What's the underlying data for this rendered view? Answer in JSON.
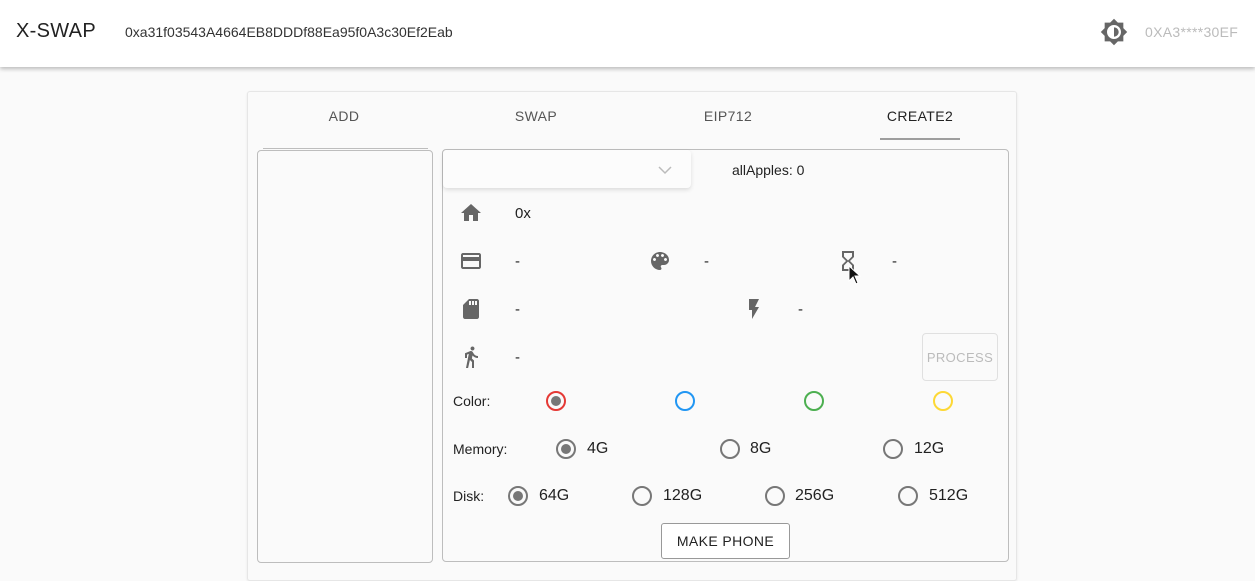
{
  "header": {
    "brand": "X-SWAP",
    "contract_address": "0xa31f03543A4664EB8DDDf88Ea95f0A3c30Ef2Eab",
    "theme_icon": "brightness-icon",
    "account": "0XA3****30EF"
  },
  "tabs": [
    {
      "label": "ADD"
    },
    {
      "label": "SWAP"
    },
    {
      "label": "EIP712"
    },
    {
      "label": "CREATE2",
      "active": true
    }
  ],
  "panel": {
    "select_value": "",
    "all_apples": "allApples: 0",
    "address_value": "0x",
    "card_value": "-",
    "palette_value": "-",
    "hourglass_value": "-",
    "storage_value": "-",
    "flash_value": "-",
    "person_value": "-",
    "process_label": "PROCESS",
    "color_label": "Color:",
    "colors": [
      {
        "hex": "#e53935",
        "checked": true
      },
      {
        "hex": "#2196f3",
        "checked": false
      },
      {
        "hex": "#4caf50",
        "checked": false
      },
      {
        "hex": "#fdd835",
        "checked": false
      }
    ],
    "memory_label": "Memory:",
    "memory_options": [
      "4G",
      "8G",
      "12G"
    ],
    "memory_selected": "4G",
    "disk_label": "Disk:",
    "disk_options": [
      "64G",
      "128G",
      "256G",
      "512G"
    ],
    "disk_selected": "64G",
    "make_phone_label": "MAKE PHONE"
  }
}
